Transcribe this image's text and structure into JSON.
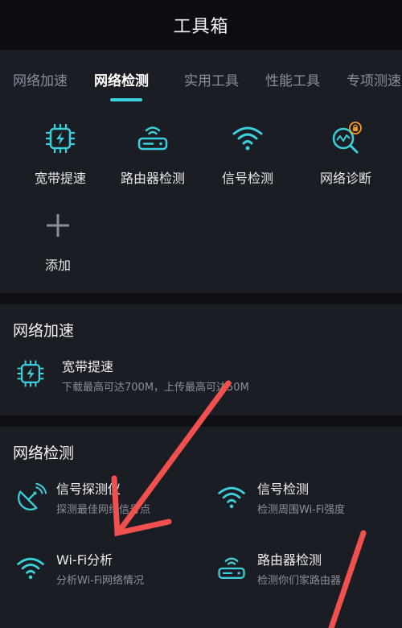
{
  "header": {
    "title": "工具箱"
  },
  "tabs": [
    {
      "label": "网络加速",
      "active": false
    },
    {
      "label": "网络检测",
      "active": true
    },
    {
      "label": "实用工具",
      "active": false
    },
    {
      "label": "性能工具",
      "active": false
    },
    {
      "label": "专项测速",
      "active": false
    }
  ],
  "quick_grid": [
    {
      "label": "宽带提速",
      "icon": "chip-bolt-icon"
    },
    {
      "label": "路由器检测",
      "icon": "router-icon"
    },
    {
      "label": "信号检测",
      "icon": "wifi-icon"
    },
    {
      "label": "网络诊断",
      "icon": "network-diagnosis-icon"
    },
    {
      "label": "添加",
      "icon": "plus-icon"
    }
  ],
  "section_accel": {
    "title": "网络加速",
    "items": [
      {
        "title": "宽带提速",
        "desc": "下载最高可达700M，上传最高可达50M",
        "icon": "chip-bolt-icon"
      }
    ]
  },
  "section_detect": {
    "title": "网络检测",
    "items": [
      {
        "title": "信号探测仪",
        "desc": "探测最佳网络信号点",
        "icon": "radar-dish-icon"
      },
      {
        "title": "信号检测",
        "desc": "检测周围Wi-Fi强度",
        "icon": "wifi-icon"
      },
      {
        "title": "Wi-Fi分析",
        "desc": "分析Wi-Fi网络情况",
        "icon": "wifi-icon"
      },
      {
        "title": "路由器检测",
        "desc": "检测你们家路由器",
        "icon": "router-icon"
      }
    ]
  },
  "colors": {
    "accent": "#3ad1dc",
    "annotation_arrow": "#f0514f",
    "badge": "#f59a23"
  }
}
